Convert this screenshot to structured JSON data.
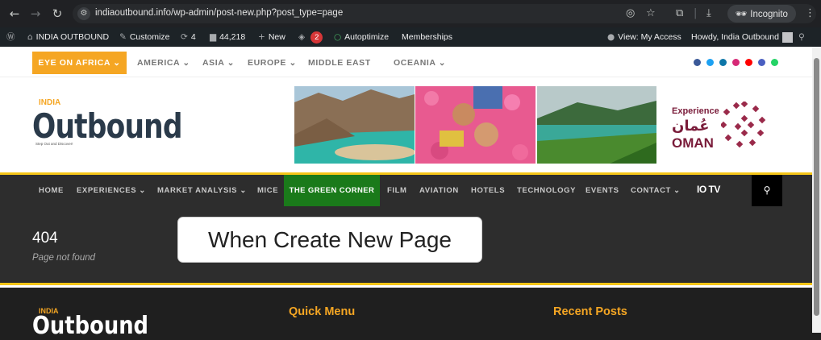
{
  "browser": {
    "url": "indiaoutbound.info/wp-admin/post-new.php?post_type=page",
    "incognito_label": "Incognito"
  },
  "adminbar": {
    "site_name": "INDIA OUTBOUND",
    "customize": "Customize",
    "updates_count": "4",
    "comments_count": "44,218",
    "new_label": "New",
    "notifications_count": "2",
    "autoptimize": "Autoptimize",
    "memberships": "Memberships",
    "view_access": "View: My Access",
    "howdy": "Howdy, India Outbound"
  },
  "topnav": {
    "featured": "EYE ON AFRICA",
    "regions": [
      {
        "label": "AMERICA",
        "dropdown": true
      },
      {
        "label": "ASIA",
        "dropdown": true
      },
      {
        "label": "EUROPE",
        "dropdown": true
      },
      {
        "label": "MIDDLE EAST",
        "dropdown": false
      },
      {
        "label": "OCEANIA",
        "dropdown": true
      }
    ],
    "social_colors": [
      "#3b5998",
      "#1da1f2",
      "#0e76a8",
      "#d62976",
      "#ff0000",
      "#4a5fc1",
      "#25d366"
    ]
  },
  "header": {
    "logo_small": "INDIA",
    "logo_main": "Outbound",
    "logo_tagline": "Step Out and Discover!",
    "ad_experience": "Experience",
    "ad_arabic": "عُمان",
    "ad_country": "OMAN"
  },
  "mainnav": {
    "items": [
      "HOME",
      "EXPERIENCES",
      "MARKET ANALYSIS",
      "MICE",
      "THE GREEN CORNER",
      "FILM",
      "AVIATION",
      "HOTELS",
      "TECHNOLOGY",
      "EVENTS",
      "CONTACT"
    ],
    "iotv": "IO TV"
  },
  "error": {
    "code": "404",
    "message": "Page not found"
  },
  "callout": {
    "text": "When Create New Page"
  },
  "footer": {
    "logo_small": "INDIA",
    "logo_main": "Outbound",
    "quick_menu": "Quick Menu",
    "recent_posts": "Recent Posts"
  },
  "colors": {
    "accent": "#f5a623",
    "nav_dark": "#2d2d2d",
    "green_corner": "#1a7a1a",
    "adminbar": "#1d2327"
  }
}
